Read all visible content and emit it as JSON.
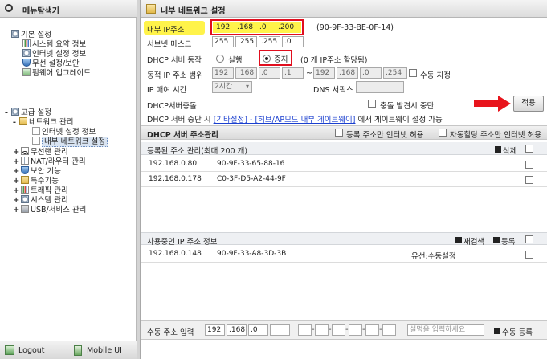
{
  "left": {
    "title": "메뉴탐색기",
    "basic_group": "기본 설정",
    "basic_items": [
      "시스템 요약 정보",
      "인터넷 설정 정보",
      "무선 설정/보안",
      "펌웨어 업그레이드"
    ],
    "advanced_group": "고급 설정",
    "network_group": "네트워크 관리",
    "network_items": [
      "인터넷 설정 정보",
      "내부 네트워크 설정"
    ],
    "advanced_items": [
      "무선랜 관리",
      "NAT/라우터 관리",
      "보안 기능",
      "특수기능",
      "트래픽 관리",
      "시스템 관리",
      "USB/서비스 관리"
    ],
    "logout": "Logout",
    "mobile_ui": "Mobile UI"
  },
  "right": {
    "title": "내부 네트워크 설정",
    "internal_ip_label": "내부 IP주소",
    "internal_ip": [
      "192",
      ".168",
      ".0",
      ".200"
    ],
    "mac": "(90-9F-33-BE-0F-14)",
    "subnet_label": "서브넷 마스크",
    "subnet": [
      "255",
      ".255",
      ".255",
      ".0"
    ],
    "dhcp_label": "DHCP 서버 동작",
    "dhcp_run": "실행",
    "dhcp_stop": "중지",
    "dhcp_note": "(0 개 IP주소 할당됨)",
    "range_label": "동적 IP 주소 범위",
    "range_start": [
      "192",
      ".168",
      ".0",
      ".1"
    ],
    "range_sep": "~",
    "range_end": [
      "192",
      ".168",
      ".0",
      ".254"
    ],
    "manual_label": "수동 지정",
    "lease_label": "IP 매여 시간",
    "lease_value": "2시간",
    "dns_label": "DNS 서픽스",
    "conflict_label": "DHCP서버충돌",
    "conflict_stop": "충돌 발견시 중단",
    "apply": "적용",
    "notice_pre": "DHCP 서버 중단 시 ",
    "notice_link": "[기타설정] - [허브/AP모드 내부 게이트웨이]",
    "notice_post": " 에서 게이트웨이 설정 가능",
    "addr_mgmt_title": "DHCP 서버 주소관리",
    "allow_registered": "등록 주소만 인터넷 허용",
    "allow_auto": "자동할당 주소만 인터넷 허용",
    "registered_title": "등록된 주소 관리(최대 200 개)",
    "delete_label": "삭제",
    "registered": [
      {
        "ip": "192.168.0.80",
        "mac": "90-9F-33-65-88-16"
      },
      {
        "ip": "192.168.0.178",
        "mac": "C0-3F-D5-A2-44-9F"
      }
    ],
    "inuse_title": "사용중인 IP 주소 정보",
    "rescan": "재검색",
    "register": "등록",
    "inuse": [
      {
        "ip": "192.168.0.148",
        "mac": "90-9F-33-A8-3D-3B",
        "type": "유선:수동설정"
      }
    ],
    "manual_input_label": "수동 주소 입력",
    "manual_ip": [
      "192",
      ".168",
      ".0",
      ""
    ],
    "desc_placeholder": "설명을 입력하세요",
    "manual_register": "수동 등록"
  },
  "colors": {
    "highlight": "#fff34a",
    "red_box": "#e10e1e",
    "arrow": "#e8141c",
    "link": "#1a3fcf"
  }
}
